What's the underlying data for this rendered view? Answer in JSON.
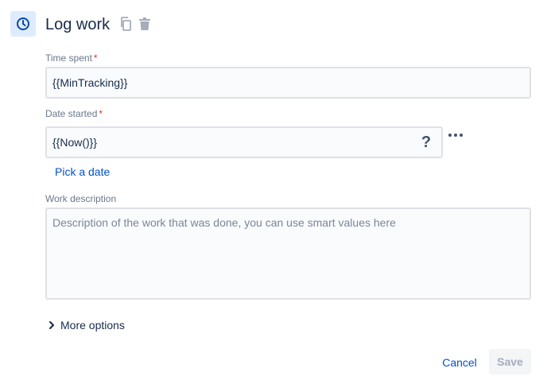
{
  "header": {
    "icon": "clock-icon",
    "title": "Log work",
    "actions": [
      {
        "icon": "copy-icon"
      },
      {
        "icon": "trash-icon"
      }
    ]
  },
  "fields": {
    "time_spent": {
      "label": "Time spent",
      "required_mark": "*",
      "value": "{{MinTracking}}"
    },
    "date_started": {
      "label": "Date started",
      "required_mark": "*",
      "value": "{{Now()}}",
      "help_icon": "question-icon",
      "help_glyph": "?",
      "more_icon": "more-icon",
      "pick_date_label": "Pick a date"
    },
    "work_description": {
      "label": "Work description",
      "placeholder": "Description of the work that was done, you can use smart values here"
    }
  },
  "more_options": {
    "icon": "chevron-right-icon",
    "label": "More options"
  },
  "footer": {
    "cancel_label": "Cancel",
    "save_label": "Save"
  },
  "colors": {
    "accent": "#0052cc",
    "icon_background": "#deebff",
    "required": "#de350b",
    "field_border": "#dfe1e6",
    "disabled_text": "#a5adba"
  }
}
